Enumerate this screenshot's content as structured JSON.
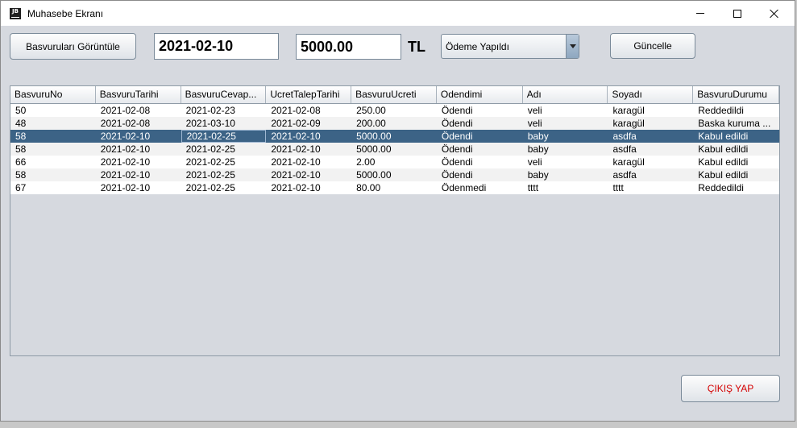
{
  "window": {
    "title": "Muhasebe Ekranı",
    "icon_text": "JB"
  },
  "toolbar": {
    "view_label": "Basvuruları Görüntüle",
    "date_value": "2021-02-10",
    "amount_value": "5000.00",
    "currency_label": "TL",
    "status_selected": "Ödeme Yapıldı",
    "update_label": "Güncelle"
  },
  "table": {
    "columns": [
      "BasvuruNo",
      "BasvuruTarihi",
      "BasvuruCevap...",
      "UcretTalepTarihi",
      "BasvuruUcreti",
      "Odendimi",
      "Adı",
      "Soyadı",
      "BasvuruDurumu"
    ],
    "rows": [
      [
        "50",
        "2021-02-08",
        "2021-02-23",
        "2021-02-08",
        "250.00",
        "Ödendi",
        "veli",
        "karagül",
        "Reddedildi"
      ],
      [
        "48",
        "2021-02-08",
        "2021-03-10",
        "2021-02-09",
        "200.00",
        "Ödendi",
        "veli",
        "karagül",
        "Baska kuruma ..."
      ],
      [
        "58",
        "2021-02-10",
        "2021-02-25",
        "2021-02-10",
        "5000.00",
        "Ödendi",
        "baby",
        "asdfa",
        "Kabul edildi"
      ],
      [
        "58",
        "2021-02-10",
        "2021-02-25",
        "2021-02-10",
        "5000.00",
        "Ödendi",
        "baby",
        "asdfa",
        "Kabul edildi"
      ],
      [
        "66",
        "2021-02-10",
        "2021-02-25",
        "2021-02-10",
        "2.00",
        "Ödendi",
        "veli",
        "karagül",
        "Kabul edildi"
      ],
      [
        "58",
        "2021-02-10",
        "2021-02-25",
        "2021-02-10",
        "5000.00",
        "Ödendi",
        "baby",
        "asdfa",
        "Kabul edildi"
      ],
      [
        "67",
        "2021-02-10",
        "2021-02-25",
        "2021-02-10",
        "80.00",
        "Ödenmedi",
        "tttt",
        "tttt",
        "Reddedildi"
      ]
    ],
    "selected_row": 2,
    "focused_cell": [
      2,
      2
    ]
  },
  "footer": {
    "exit_label": "ÇIKIŞ YAP"
  },
  "colors": {
    "selection": "#3c6386",
    "exit_text": "#d40000",
    "background": "#d6d9df"
  }
}
